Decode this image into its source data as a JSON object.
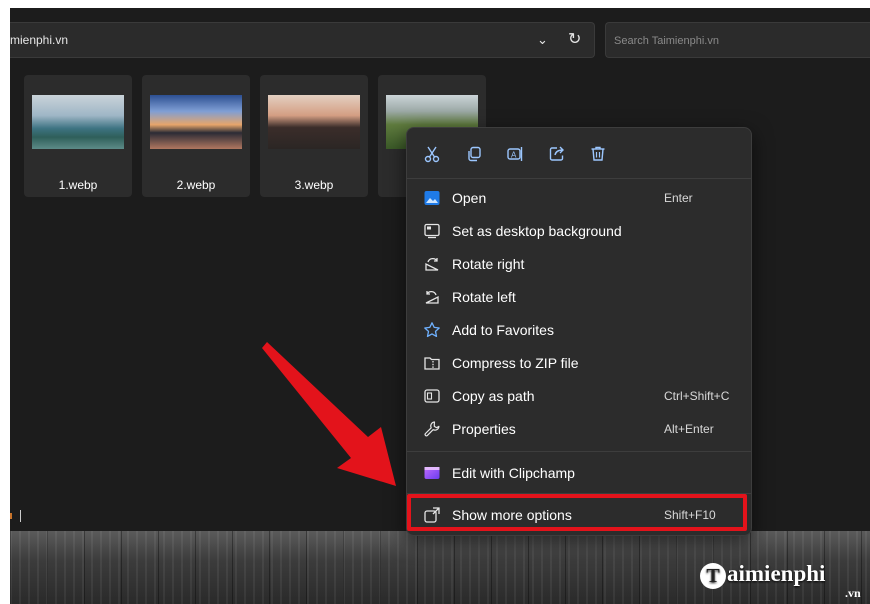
{
  "address_bar": {
    "path": "mienphi.vn",
    "dropdown_icon": "chevron-down-icon",
    "refresh_icon": "refresh-icon"
  },
  "search": {
    "placeholder": "Search Taimienphi.vn"
  },
  "files": [
    {
      "name": "1.webp"
    },
    {
      "name": "2.webp"
    },
    {
      "name": "3.webp"
    },
    {
      "name": ""
    }
  ],
  "context_menu": {
    "quick_actions": [
      {
        "icon": "cut-icon"
      },
      {
        "icon": "copy-icon"
      },
      {
        "icon": "rename-icon"
      },
      {
        "icon": "share-icon"
      },
      {
        "icon": "delete-icon"
      }
    ],
    "items": [
      {
        "label": "Open",
        "shortcut": "Enter",
        "icon": "photos-app-icon"
      },
      {
        "label": "Set as desktop background",
        "shortcut": "",
        "icon": "desktop-background-icon"
      },
      {
        "label": "Rotate right",
        "shortcut": "",
        "icon": "rotate-right-icon"
      },
      {
        "label": "Rotate left",
        "shortcut": "",
        "icon": "rotate-left-icon"
      },
      {
        "label": "Add to Favorites",
        "shortcut": "",
        "icon": "star-icon"
      },
      {
        "label": "Compress to ZIP file",
        "shortcut": "",
        "icon": "zip-folder-icon"
      },
      {
        "label": "Copy as path",
        "shortcut": "Ctrl+Shift+C",
        "icon": "copy-path-icon"
      },
      {
        "label": "Properties",
        "shortcut": "Alt+Enter",
        "icon": "wrench-icon"
      },
      {
        "label": "Edit with Clipchamp",
        "shortcut": "",
        "icon": "clipchamp-icon"
      },
      {
        "label": "Show more options",
        "shortcut": "Shift+F10",
        "icon": "more-options-icon"
      }
    ]
  },
  "annotation": {
    "highlight_color": "#e3131b",
    "highlighted_item": "Show more options"
  },
  "watermark": {
    "brand": "aimienphi",
    "suffix": ".vn"
  }
}
